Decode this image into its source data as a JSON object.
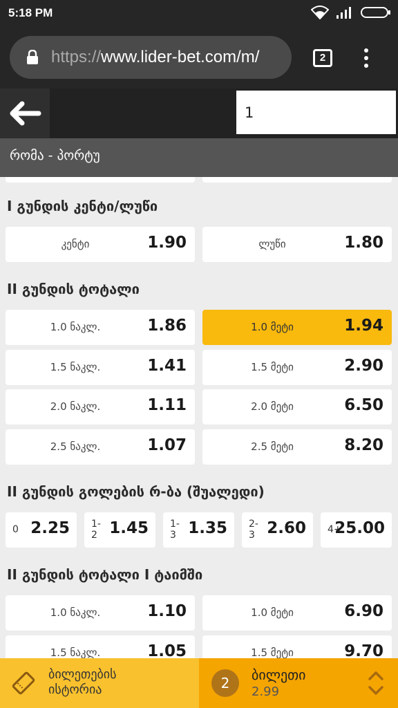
{
  "status": {
    "time": "5:18 PM"
  },
  "browser": {
    "url_scheme": "https://",
    "url_rest": "www.lider-bet.com/m/",
    "tab_count": "2"
  },
  "header": {
    "stake_value": "1"
  },
  "match": {
    "title": "რომა - პორტუ"
  },
  "sections": {
    "even_odd": {
      "title": "I გუნდის კენტი/ლუწი",
      "options": [
        {
          "label": "კენტი",
          "odd": "1.90"
        },
        {
          "label": "ლუწი",
          "odd": "1.80"
        }
      ]
    },
    "team2_total": {
      "title": "II გუნდის ტოტალი",
      "rows": [
        {
          "under_label": "1.0 ნაკლ.",
          "under_odd": "1.86",
          "over_label": "1.0 მეტი",
          "over_odd": "1.94"
        },
        {
          "under_label": "1.5 ნაკლ.",
          "under_odd": "1.41",
          "over_label": "1.5 მეტი",
          "over_odd": "2.90"
        },
        {
          "under_label": "2.0 ნაკლ.",
          "under_odd": "1.11",
          "over_label": "2.0 მეტი",
          "over_odd": "6.50"
        },
        {
          "under_label": "2.5 ნაკლ.",
          "under_odd": "1.07",
          "over_label": "2.5 მეტი",
          "over_odd": "8.20"
        }
      ]
    },
    "team2_goals_range": {
      "title": "II გუნდის გოლების რ-ბა (შუალედი)",
      "options": [
        {
          "top": "0",
          "bottom": "",
          "odd": "2.25"
        },
        {
          "top": "1-",
          "bottom": "2",
          "odd": "1.45"
        },
        {
          "top": "1-",
          "bottom": "3",
          "odd": "1.35"
        },
        {
          "top": "2-",
          "bottom": "3",
          "odd": "2.60"
        },
        {
          "top": "4+",
          "bottom": "",
          "odd": "25.00"
        }
      ]
    },
    "team2_total_first_half": {
      "title": "II გუნდის ტოტალი I ტაიმში",
      "rows": [
        {
          "under_label": "1.0 ნაკლ.",
          "under_odd": "1.10",
          "over_label": "1.0 მეტი",
          "over_odd": "6.90"
        },
        {
          "under_label": "1.5 ნაკლ.",
          "under_odd": "1.05",
          "over_label": "1.5 მეტი",
          "over_odd": "9.70"
        }
      ]
    }
  },
  "bottom": {
    "history_line1": "ბილეთების",
    "history_line2": "ისტორია",
    "ticket_count": "2",
    "ticket_title": "ბილეთი",
    "ticket_total": "2.99"
  },
  "colors": {
    "accent": "#f9b90d",
    "dark": "#222222",
    "ticket": "#f5a500"
  },
  "icons": [
    "wifi-icon",
    "signal-icon",
    "battery-icon",
    "lock-icon",
    "back-arrow-icon",
    "ticket-icon",
    "chevron-up-down-icon"
  ]
}
